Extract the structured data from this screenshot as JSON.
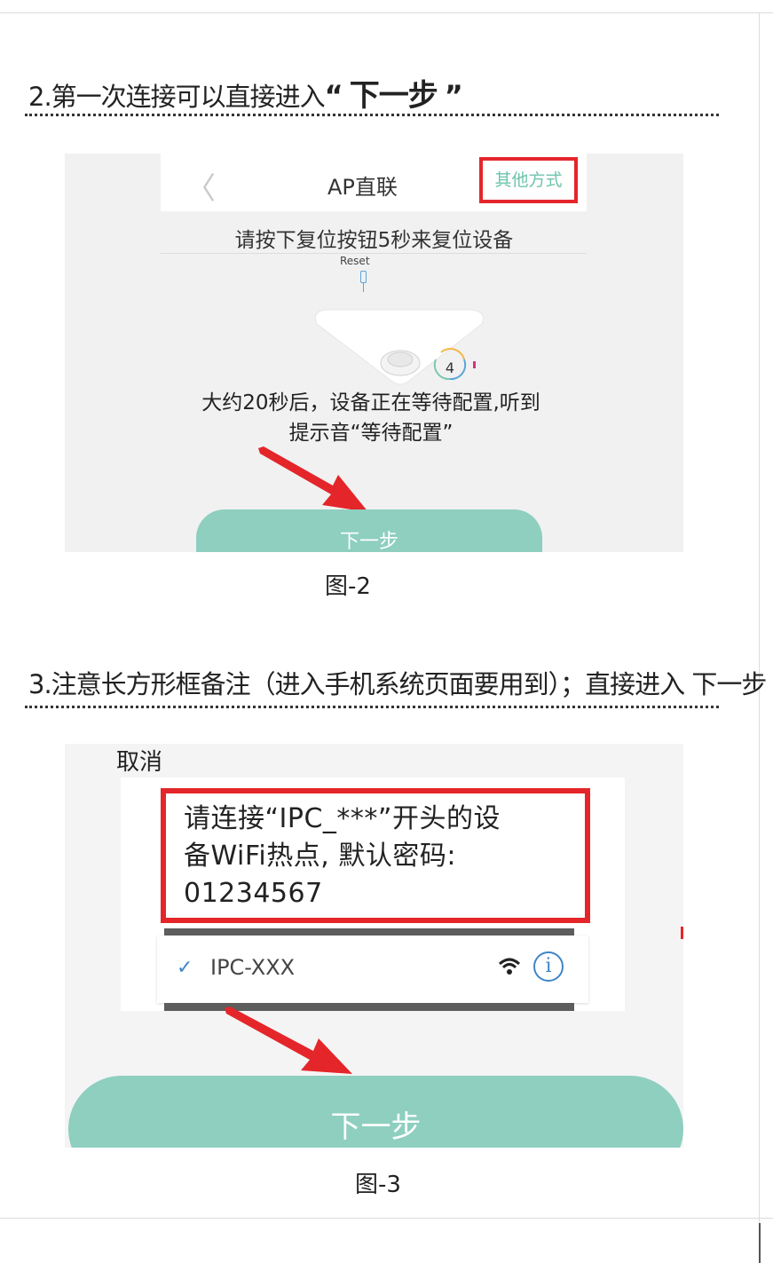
{
  "step2": {
    "title_prefix": "2.第一次连接可以直接进入",
    "open_quote": "“",
    "emphasis": "下一步",
    "close_quote": "”"
  },
  "figure2": {
    "back_glyph": "〈",
    "nav_title": "AP直联",
    "other_methods": "其他方式",
    "instruction": "请按下复位按钮5秒来复位设备",
    "reset_label": "Reset",
    "countdown": "4",
    "wait_line1": "大约20秒后，设备正在等待配置,听到",
    "wait_line2": "提示音“等待配置”",
    "next_button": "下一步",
    "caption": "图-2"
  },
  "step3": {
    "title": "3.注意长方形框备注（进入手机系统页面要用到）；直接进入 下一步"
  },
  "figure3": {
    "cancel": "取消",
    "note_line1": "请连接“IPC_***”开头的设",
    "note_line2": "备WiFi热点, 默认密码:",
    "note_line3": "01234567",
    "check_glyph": "✓",
    "ssid": "IPC-XXX",
    "info_glyph": "i",
    "next_button": "下一步",
    "caption": "图-3"
  },
  "colors": {
    "accent_green": "#8ecfbf",
    "highlight_red": "#e4262a",
    "link_blue": "#3d86c8"
  },
  "icons": [
    "back-chevron-icon",
    "reset-button-icon",
    "device-icon",
    "countdown-ring-icon",
    "red-arrow-icon",
    "checkmark-icon",
    "wifi-icon",
    "info-icon"
  ]
}
